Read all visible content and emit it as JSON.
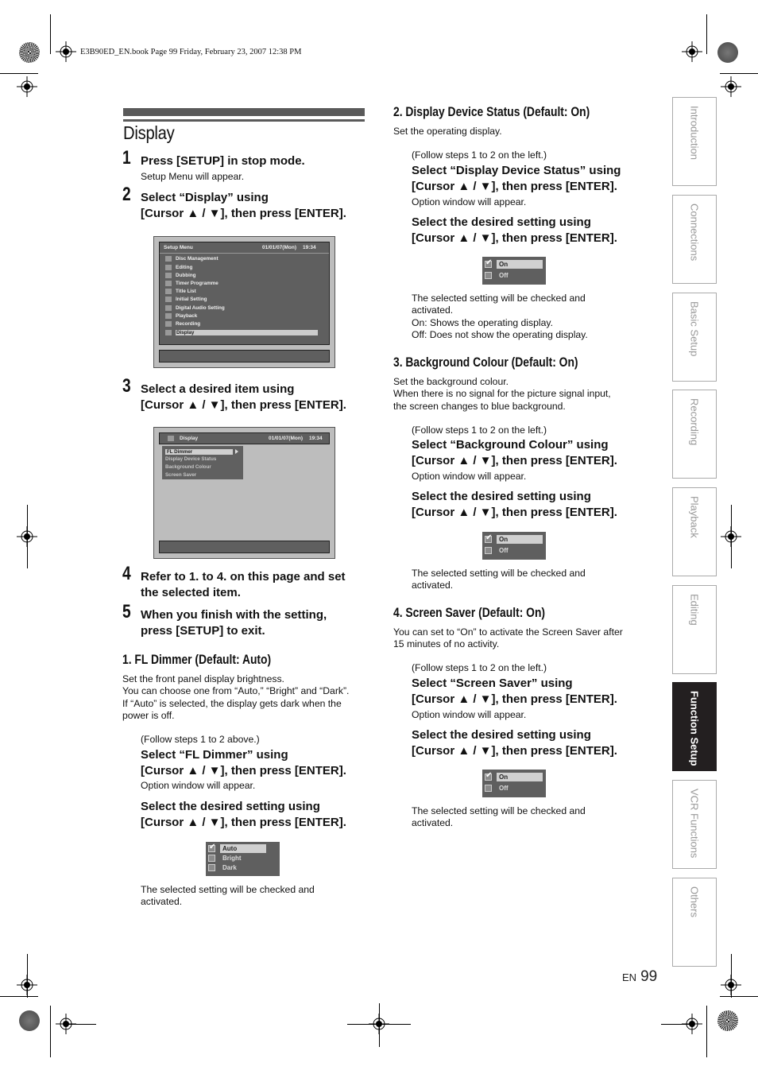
{
  "print_header": "E3B90ED_EN.book  Page 99  Friday, February 23, 2007  12:38 PM",
  "page_title": "Display",
  "steps": [
    {
      "num": "1",
      "text": "Press [SETUP] in stop mode.",
      "note": "Setup Menu will appear."
    },
    {
      "num": "2",
      "text_line1": "Select “Display” using",
      "text_line2": "[Cursor ▲ / ▼], then press [ENTER]."
    },
    {
      "num": "3",
      "text_line1": "Select a desired item using",
      "text_line2": "[Cursor ▲ / ▼], then press [ENTER]."
    },
    {
      "num": "4",
      "text_line1": "Refer to 1. to 4. on this page and set",
      "text_line2": "the selected item."
    },
    {
      "num": "5",
      "text_line1": "When you finish with the setting,",
      "text_line2": "press [SETUP] to exit."
    }
  ],
  "setup_menu_screen": {
    "title": "Setup Menu",
    "date": "01/01/07(Mon)",
    "time": "19:34",
    "items": [
      "Disc Management",
      "Editing",
      "Dubbing",
      "Timer Programme",
      "Title List",
      "Initial Setting",
      "Digital Audio Setting",
      "Playback",
      "Recording",
      "Display"
    ],
    "selected": "Display"
  },
  "display_screen": {
    "title": "Display",
    "date": "01/01/07(Mon)",
    "time": "19:34",
    "items": [
      "FL Dimmer",
      "Display Device Status",
      "Background Colour",
      "Screen Saver"
    ],
    "selected": "FL Dimmer"
  },
  "sections": {
    "fl_dimmer": {
      "heading": "1. FL Dimmer (Default: Auto)",
      "desc": [
        "Set the front panel display brightness.",
        "You can choose one from “Auto,” “Bright” and “Dark”.",
        "If “Auto” is selected, the display gets dark when the",
        "power is off."
      ],
      "follow": "(Follow steps 1 to 2 above.)",
      "select_l1": "Select “FL Dimmer” using",
      "select_l2": "[Cursor ▲ / ▼], then press [ENTER].",
      "option_note": "Option window will appear.",
      "desired_l1": "Select the desired setting using",
      "desired_l2": "[Cursor ▲ / ▼], then press [ENTER].",
      "options": [
        "Auto",
        "Bright",
        "Dark"
      ],
      "checked": "Auto",
      "result": [
        "The selected setting will be checked and",
        "activated."
      ]
    },
    "display_device_status": {
      "heading": "2. Display Device Status (Default: On)",
      "desc": [
        "Set the operating display."
      ],
      "follow": "(Follow steps 1 to 2 on the left.)",
      "select_l1": "Select “Display Device Status” using",
      "select_l2": "[Cursor ▲ / ▼], then press [ENTER].",
      "option_note": "Option window will appear.",
      "desired_l1": "Select the desired setting using",
      "desired_l2": "[Cursor ▲ / ▼], then press [ENTER].",
      "options": [
        "On",
        "Off"
      ],
      "checked": "On",
      "result": [
        "The selected setting will be checked and",
        "activated.",
        "On: Shows the operating display.",
        "Off: Does not show the operating display."
      ]
    },
    "background_colour": {
      "heading": "3. Background Colour (Default: On)",
      "desc": [
        "Set the background colour.",
        "When there is no signal for the picture signal input,",
        "the screen changes to blue background."
      ],
      "follow": "(Follow steps 1 to 2 on the left.)",
      "select_l1": "Select “Background Colour” using",
      "select_l2": "[Cursor ▲ / ▼], then press [ENTER].",
      "option_note": "Option window will appear.",
      "desired_l1": "Select the desired setting using",
      "desired_l2": "[Cursor ▲ / ▼], then press [ENTER].",
      "options": [
        "On",
        "Off"
      ],
      "checked": "On",
      "result": [
        "The selected setting will be checked and",
        "activated."
      ]
    },
    "screen_saver": {
      "heading": "4. Screen Saver (Default: On)",
      "desc": [
        "You can set to “On” to activate the Screen Saver after",
        "15 minutes of no activity."
      ],
      "follow": "(Follow steps 1 to 2 on the left.)",
      "select_l1": "Select “Screen Saver” using",
      "select_l2": "[Cursor ▲ / ▼], then press [ENTER].",
      "option_note": "Option window will appear.",
      "desired_l1": "Select the desired setting using",
      "desired_l2": "[Cursor ▲ / ▼], then press [ENTER].",
      "options": [
        "On",
        "Off"
      ],
      "checked": "On",
      "result": [
        "The selected setting will be checked and",
        "activated."
      ]
    }
  },
  "side_tabs": [
    {
      "label": "Introduction",
      "active": false
    },
    {
      "label": "Connections",
      "active": false
    },
    {
      "label": "Basic Setup",
      "active": false
    },
    {
      "label": "Recording",
      "active": false
    },
    {
      "label": "Playback",
      "active": false
    },
    {
      "label": "Editing",
      "active": false
    },
    {
      "label": "Function Setup",
      "active": true
    },
    {
      "label": "VCR Functions",
      "active": false
    },
    {
      "label": "Others",
      "active": false
    }
  ],
  "footer": {
    "lang": "EN",
    "page": "99"
  }
}
